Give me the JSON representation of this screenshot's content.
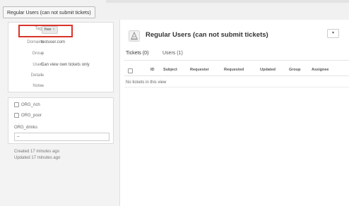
{
  "org_tab": {
    "label": "Regular Users (can not submit tickets)"
  },
  "properties": {
    "tags_label": "Tags",
    "tag": "free",
    "tag_remove": "×",
    "domains_label": "Domains",
    "domains_value": "testuser.com",
    "group_label": "Group",
    "group_value": "–",
    "users_label": "Users",
    "users_value": "Can view own tickets only",
    "details_label": "Details",
    "details_value": "–",
    "notes_label": "Notes",
    "notes_value": "–"
  },
  "custom_fields": {
    "checkbox1": "ORG_rich",
    "checkbox2": "ORG_poor",
    "drinks_label": "ORG_drinks",
    "drinks_value": "–"
  },
  "meta": {
    "created": "Created  17 minutes ago",
    "updated": "Updated  17 minutes ago"
  },
  "main": {
    "title": "Regular Users (can not submit tickets)",
    "dropdown": "▾",
    "tabs": [
      {
        "label": "Tickets (0)"
      },
      {
        "label": "Users (1)"
      }
    ],
    "columns": [
      "ID",
      "Subject",
      "Requester",
      "Requested",
      "Updated",
      "Group",
      "Assignee"
    ],
    "empty_message": "No tickets in this view"
  },
  "colors": {
    "highlight": "#d9332a"
  }
}
